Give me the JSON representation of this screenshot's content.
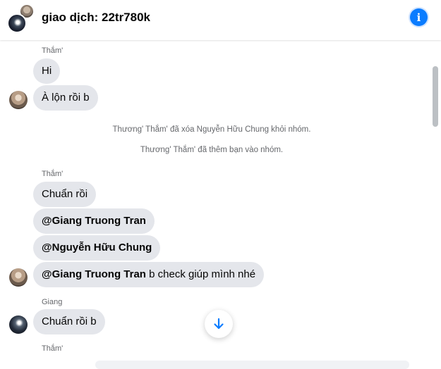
{
  "header": {
    "title": "giao dịch: 22tr780k"
  },
  "messages": {
    "block1": {
      "sender": "Thắm'",
      "msg1": "Hi",
      "msg2": "À lộn rồi b"
    },
    "system": {
      "line1": "Thương' Thắm' đã xóa Nguyễn Hữu Chung khỏi nhóm.",
      "line2": "Thương' Thắm' đã thêm bạn vào nhóm."
    },
    "block2": {
      "sender": "Thắm'",
      "msg1": "Chuẩn rồi",
      "msg2_mention": "@Giang Truong Tran",
      "msg3_mention": "@Nguyễn Hữu Chung",
      "msg4_mention": "@Giang Truong Tran",
      "msg4_text": " b check giúp mình nhé"
    },
    "block3": {
      "sender": "Giang",
      "msg1": "Chuẩn rồi b"
    },
    "block4": {
      "sender": "Thắm'"
    }
  },
  "icons": {
    "info": "info-icon",
    "scroll_down": "arrow-down-icon"
  },
  "colors": {
    "accent": "#0a7cff",
    "bubble": "#e4e6eb",
    "secondary_text": "#65676b"
  }
}
